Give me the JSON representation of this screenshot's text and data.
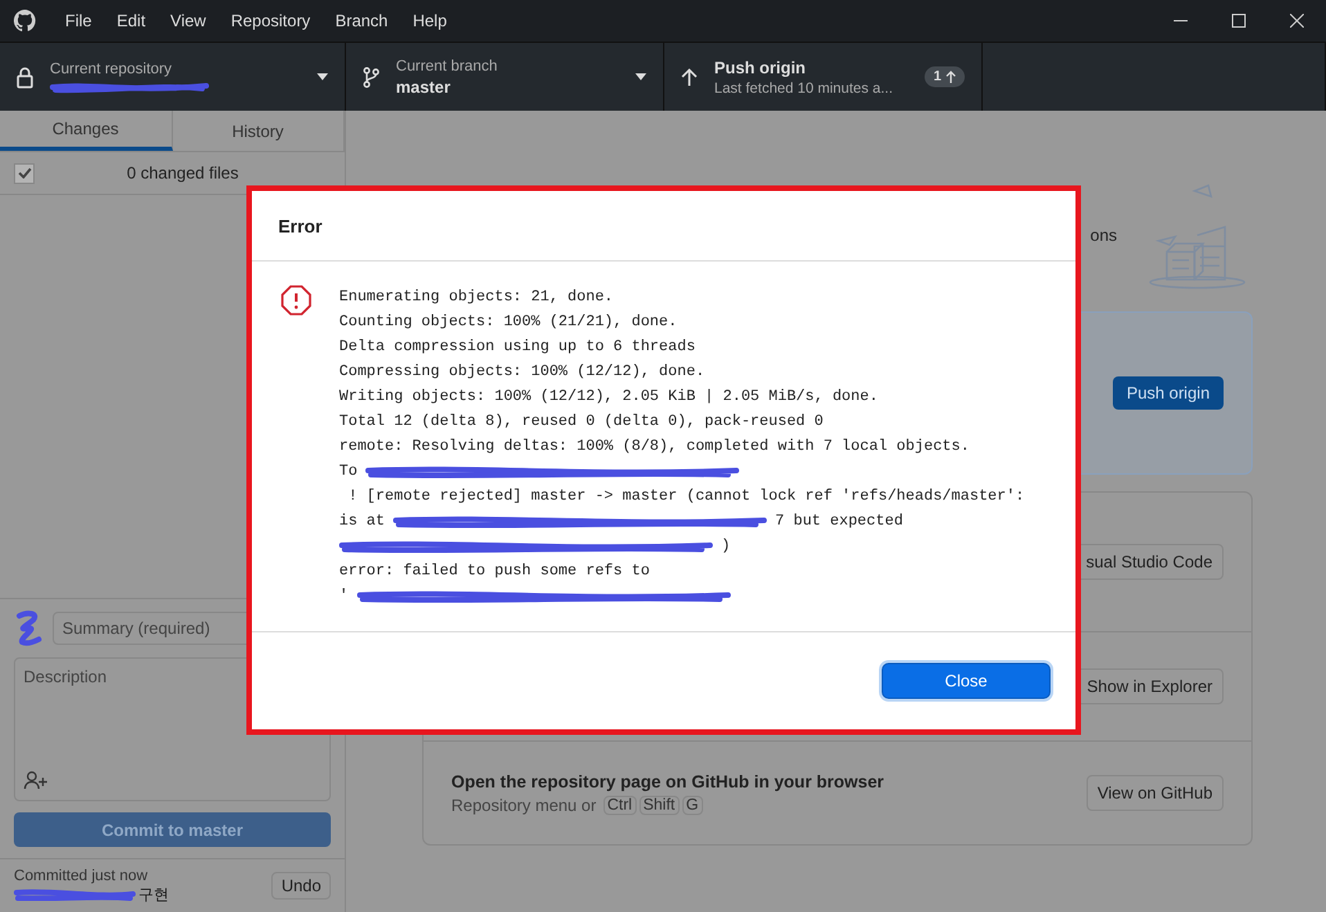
{
  "menu": [
    "File",
    "Edit",
    "View",
    "Repository",
    "Branch",
    "Help"
  ],
  "toolbar": {
    "repository": {
      "label": "Current repository"
    },
    "branch": {
      "label": "Current branch",
      "value": "master"
    },
    "push": {
      "title": "Push origin",
      "subtitle": "Last fetched 10 minutes a...",
      "badge": "1"
    }
  },
  "sidebar": {
    "tabs": [
      {
        "label": "Changes",
        "selected": true
      },
      {
        "label": "History",
        "selected": false
      }
    ],
    "changed_files": {
      "label": "0 changed files",
      "checked": true
    },
    "summary": {
      "placeholder": "Summary (required)"
    },
    "description": {
      "placeholder": "Description"
    },
    "commit_button": "Commit to master",
    "last_commit": {
      "label": "Committed just now",
      "message": "구현",
      "undo": "Undo"
    }
  },
  "main": {
    "intro_fragment": "ons",
    "push_card": {
      "button": "Push origin"
    },
    "actions": [
      {
        "button": "sual Studio Code"
      },
      {
        "button": "Show in Explorer"
      },
      {
        "title": "Open the repository page on GitHub in your browser",
        "hint": "Repository menu or",
        "keys": [
          "Ctrl",
          "Shift",
          "G"
        ],
        "button": "View on GitHub"
      }
    ]
  },
  "dialog": {
    "title": "Error",
    "button": "Close",
    "lines": [
      [
        {
          "kind": "text",
          "text": "Enumerating objects: 21, done."
        }
      ],
      [
        {
          "kind": "text",
          "text": "Counting objects: 100% (21/21), done."
        }
      ],
      [
        {
          "kind": "text",
          "text": "Delta compression using up to 6 threads"
        }
      ],
      [
        {
          "kind": "text",
          "text": "Compressing objects: 100% (12/12), done."
        }
      ],
      [
        {
          "kind": "text",
          "text": "Writing objects: 100% (12/12), 2.05 KiB | 2.05 MiB/s, done."
        }
      ],
      [
        {
          "kind": "text",
          "text": "Total 12 (delta 8), reused 0 (delta 0), pack-reused 0"
        }
      ],
      [
        {
          "kind": "text",
          "text": "remote: Resolving deltas: 100% (8/8), completed with 7 local objects."
        }
      ],
      [
        {
          "kind": "text",
          "text": "To"
        },
        {
          "kind": "redacted"
        }
      ],
      [
        {
          "kind": "text",
          "text": " ! [remote rejected] master -> master (cannot lock ref 'refs/heads/master':"
        }
      ],
      [
        {
          "kind": "text",
          "text": "is at"
        },
        {
          "kind": "redacted"
        },
        {
          "kind": "text",
          "text": "7 but expected"
        }
      ],
      [
        {
          "kind": "redacted"
        },
        {
          "kind": "text",
          "text": ")"
        }
      ],
      [
        {
          "kind": "text",
          "text": "error: failed to push some refs to"
        }
      ],
      [
        {
          "kind": "text",
          "text": "'"
        },
        {
          "kind": "redacted"
        }
      ]
    ]
  }
}
